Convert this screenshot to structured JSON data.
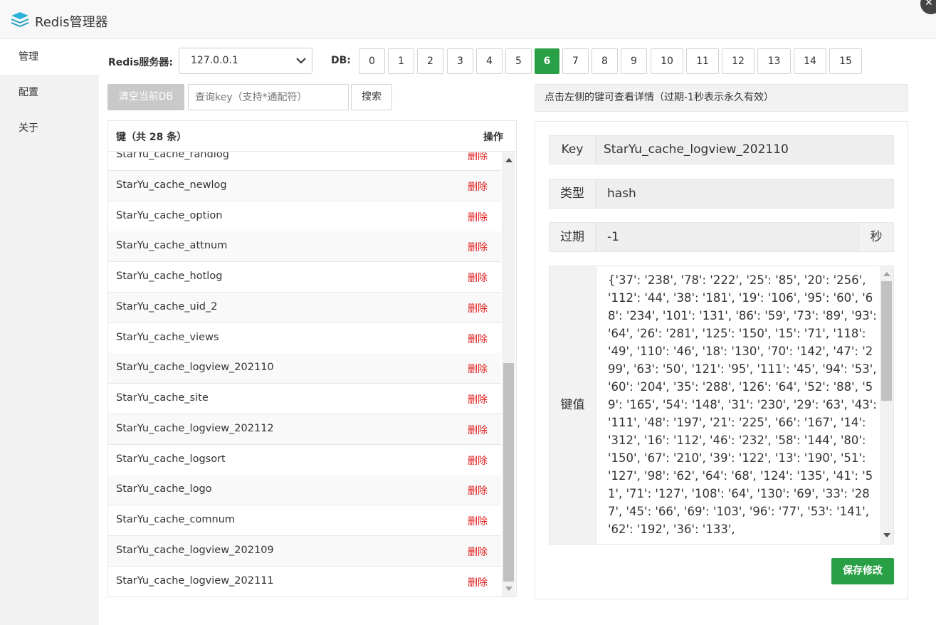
{
  "app": {
    "title": "Redis管理器",
    "close_glyph": "✕"
  },
  "sidebar": {
    "items": [
      {
        "label": "管理",
        "active": true
      },
      {
        "label": "配置",
        "active": false
      },
      {
        "label": "关于",
        "active": false
      }
    ]
  },
  "toolbar": {
    "server_label": "Redis服务器:",
    "server_value": "127.0.0.1",
    "db_label": "DB:",
    "db_options": [
      "0",
      "1",
      "2",
      "3",
      "4",
      "5",
      "6",
      "7",
      "8",
      "9",
      "10",
      "11",
      "12",
      "13",
      "14",
      "15"
    ],
    "db_selected": "6",
    "clear_label": "清空当前DB",
    "search_placeholder": "查询key（支持*通配符）",
    "search_label": "搜索"
  },
  "keylist": {
    "header_key": "键（共 28 条）",
    "header_op": "操作",
    "delete_label": "删除",
    "rows": [
      "StarYu_cache_randlog",
      "StarYu_cache_newlog",
      "StarYu_cache_option",
      "StarYu_cache_attnum",
      "StarYu_cache_hotlog",
      "StarYu_cache_uid_2",
      "StarYu_cache_views",
      "StarYu_cache_logview_202110",
      "StarYu_cache_site",
      "StarYu_cache_logview_202112",
      "StarYu_cache_logsort",
      "StarYu_cache_logo",
      "StarYu_cache_comnum",
      "StarYu_cache_logview_202109",
      "StarYu_cache_logview_202111"
    ]
  },
  "detail": {
    "hint": "点击左侧的键可查看详情（过期-1秒表示永久有效）",
    "key_label": "Key",
    "key_value": "StarYu_cache_logview_202110",
    "type_label": "类型",
    "type_value": "hash",
    "expire_label": "过期",
    "expire_value": "-1",
    "expire_unit": "秒",
    "value_label": "键值",
    "value_text": "{'37': '238', '78': '222', '25': '85', '20': '256', '112': '44', '38': '181', '19': '106', '95': '60', '68': '234', '101': '131', '86': '59', '73': '89', '93': '64', '26': '281', '125': '150', '15': '71', '118': '49', '110': '46', '18': '130', '70': '142', '47': '299', '63': '50', '121': '95', '111': '45', '94': '53', '60': '204', '35': '288', '126': '64', '52': '88', '59': '165', '54': '148', '31': '230', '29': '63', '43': '111', '48': '197', '21': '225', '66': '167', '14': '312', '16': '112', '46': '232', '58': '144', '80': '150', '67': '210', '39': '122', '13': '190', '51': '127', '98': '62', '64': '68', '124': '135', '41': '51', '71': '127', '108': '64', '130': '69', '33': '287', '45': '66', '69': '103', '96': '77', '53': '141', '62': '192', '36': '133',",
    "save_label": "保存修改"
  },
  "colors": {
    "accent": "#2aa046",
    "danger": "#e02020",
    "sidebar_bg": "#f2f2f2"
  }
}
